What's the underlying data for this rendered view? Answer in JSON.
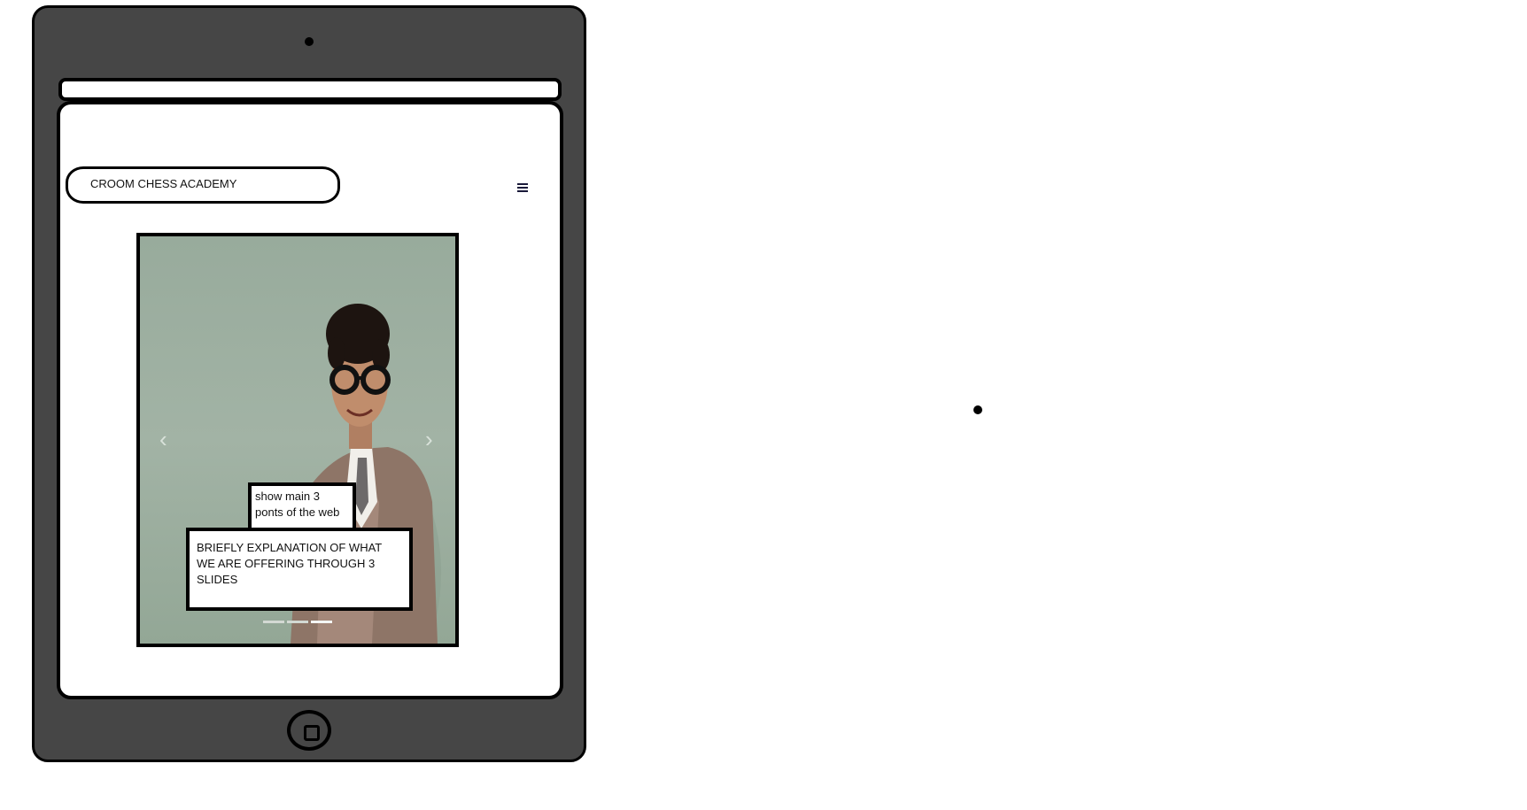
{
  "header": {
    "brand": "CROOM CHESS ACADEMY",
    "menu_icon": "hamburger-menu-icon"
  },
  "carousel": {
    "prev_icon": "chevron-left-icon",
    "next_icon": "chevron-right-icon",
    "prev_glyph": "‹",
    "next_glyph": "›",
    "note_points": "show main 3 ponts of the web",
    "note_explanation": "BRIEFLY EXPLANATION OF WHAT WE ARE OFFERING THROUGH 3 SLIDES",
    "slide_count": 3,
    "active_slide": 3
  },
  "device": {
    "frame_color": "#464646",
    "home_button_icon": "home-button-icon",
    "camera_icon": "camera-dot-icon"
  }
}
